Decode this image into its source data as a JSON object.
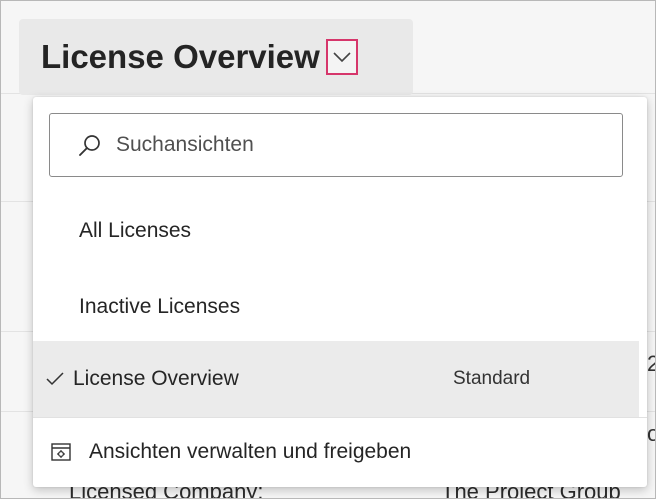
{
  "header": {
    "title": "License Overview"
  },
  "view_menu": {
    "search": {
      "placeholder": "Suchansichten",
      "icon": "search-icon"
    },
    "items": [
      {
        "label": "All Licenses",
        "selected": false
      },
      {
        "label": "Inactive Licenses",
        "selected": false
      },
      {
        "label": "License Overview",
        "selected": true,
        "tag": "Standard"
      }
    ],
    "manage_label": "Ansichten verwalten und freigeben"
  },
  "background": {
    "right_fragments": [
      "2",
      "o"
    ],
    "bottom_left_label": "Licensed Company:",
    "bottom_right_value": "The Project Group"
  },
  "colors": {
    "focus_border": "#d6366b",
    "selected_bg": "#ebebeb",
    "title_bg": "#e9e9e9"
  }
}
